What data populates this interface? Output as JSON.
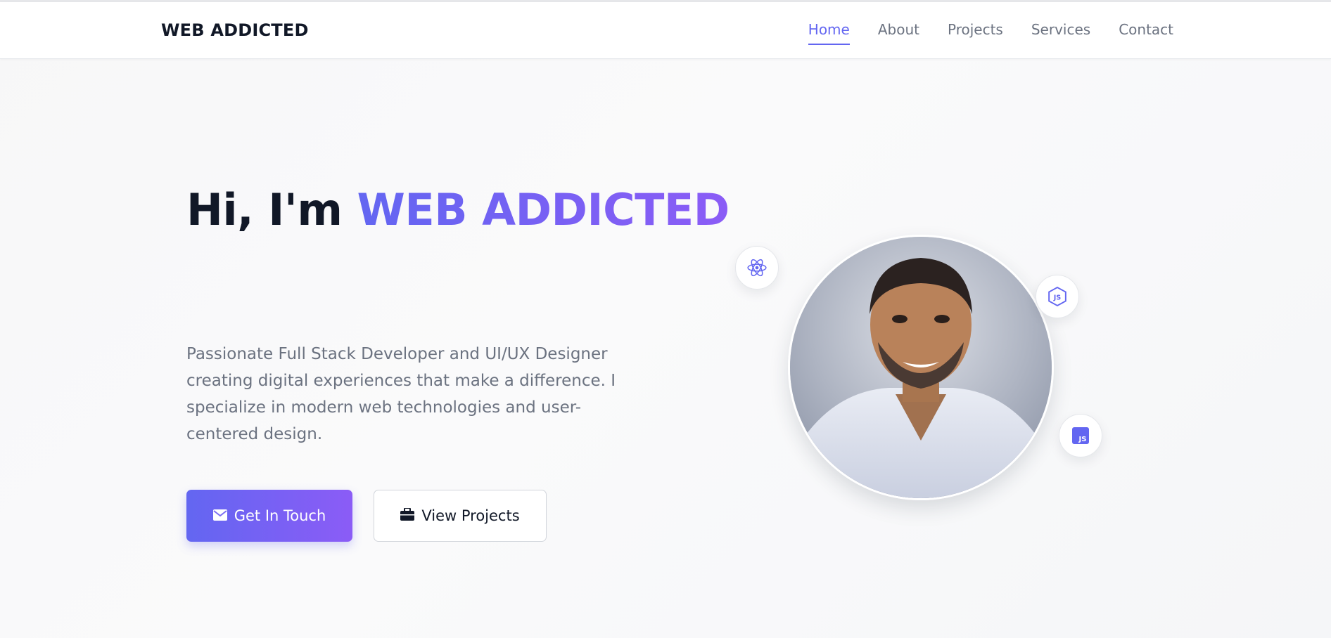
{
  "brand": "WEB ADDICTED",
  "nav": {
    "home": "Home",
    "about": "About",
    "projects": "Projects",
    "services": "Services",
    "contact": "Contact"
  },
  "hero": {
    "greeting": "Hi, I'm",
    "name": "WEB ADDICTED",
    "description": "Passionate Full Stack Developer and UI/UX Designer creating digital experiences that make a difference. I specialize in modern web technologies and user-centered design."
  },
  "buttons": {
    "primary_label": "Get In Touch",
    "primary_icon": "envelope-icon",
    "secondary_label": "View Projects",
    "secondary_icon": "briefcase-icon"
  },
  "tech_icons": {
    "react": "react-icon",
    "node": "nodejs-icon",
    "js": "javascript-icon",
    "js_text": "JS"
  },
  "colors": {
    "accent": "#6366f1",
    "accent_2": "#8b5cf6",
    "text_dark": "#111827",
    "text_muted": "#6b7280"
  }
}
